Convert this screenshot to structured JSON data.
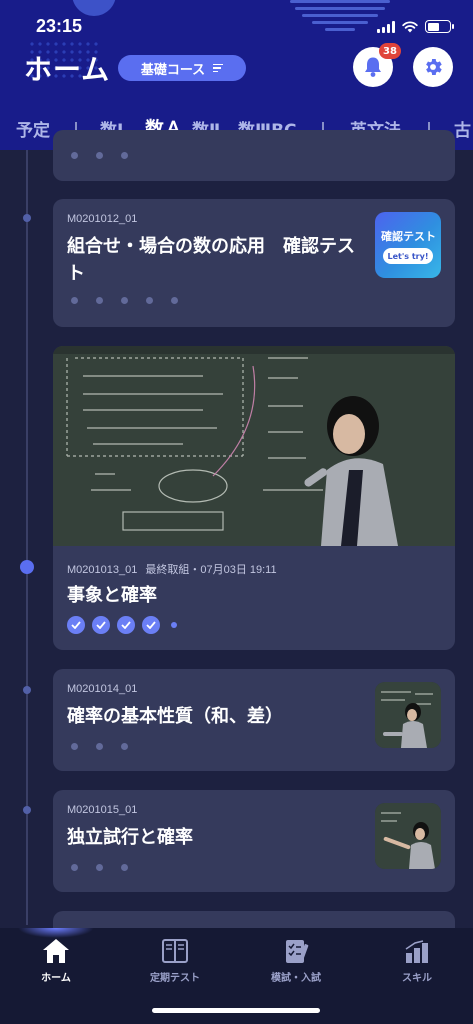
{
  "status_bar": {
    "time": "23:15"
  },
  "header": {
    "title": "ホーム",
    "course_pill": "基礎コース",
    "notification_count": "38",
    "accent": "#5a6ef0"
  },
  "tabs": [
    {
      "label": "予定"
    },
    {
      "label": "数Ⅰ"
    },
    {
      "label": "数Ａ",
      "active": true
    },
    {
      "label": "数Ⅱ"
    },
    {
      "label": "数ⅢBC"
    },
    {
      "label": "英文法"
    },
    {
      "label": "古"
    }
  ],
  "lessons": [
    {
      "code": "M0201012_01",
      "title": "組合せ・場合の数の応用　確認テスト",
      "thumb_line1": "確認テスト",
      "thumb_line2": "Let's try!"
    },
    {
      "code": "M0201013_01",
      "last_label": "最終取組・07月03日 19:11",
      "title": "事象と確率",
      "completed": 4,
      "total": 5
    },
    {
      "code": "M0201014_01",
      "title": "確率の基本性質（和、差）"
    },
    {
      "code": "M0201015_01",
      "title": "独立試行と確率"
    }
  ],
  "bottom_nav": [
    {
      "label": "ホーム",
      "icon": "home-icon",
      "active": true
    },
    {
      "label": "定期テスト",
      "icon": "book-icon"
    },
    {
      "label": "模試・入試",
      "icon": "exam-icon"
    },
    {
      "label": "スキル",
      "icon": "skill-chart-icon"
    }
  ]
}
